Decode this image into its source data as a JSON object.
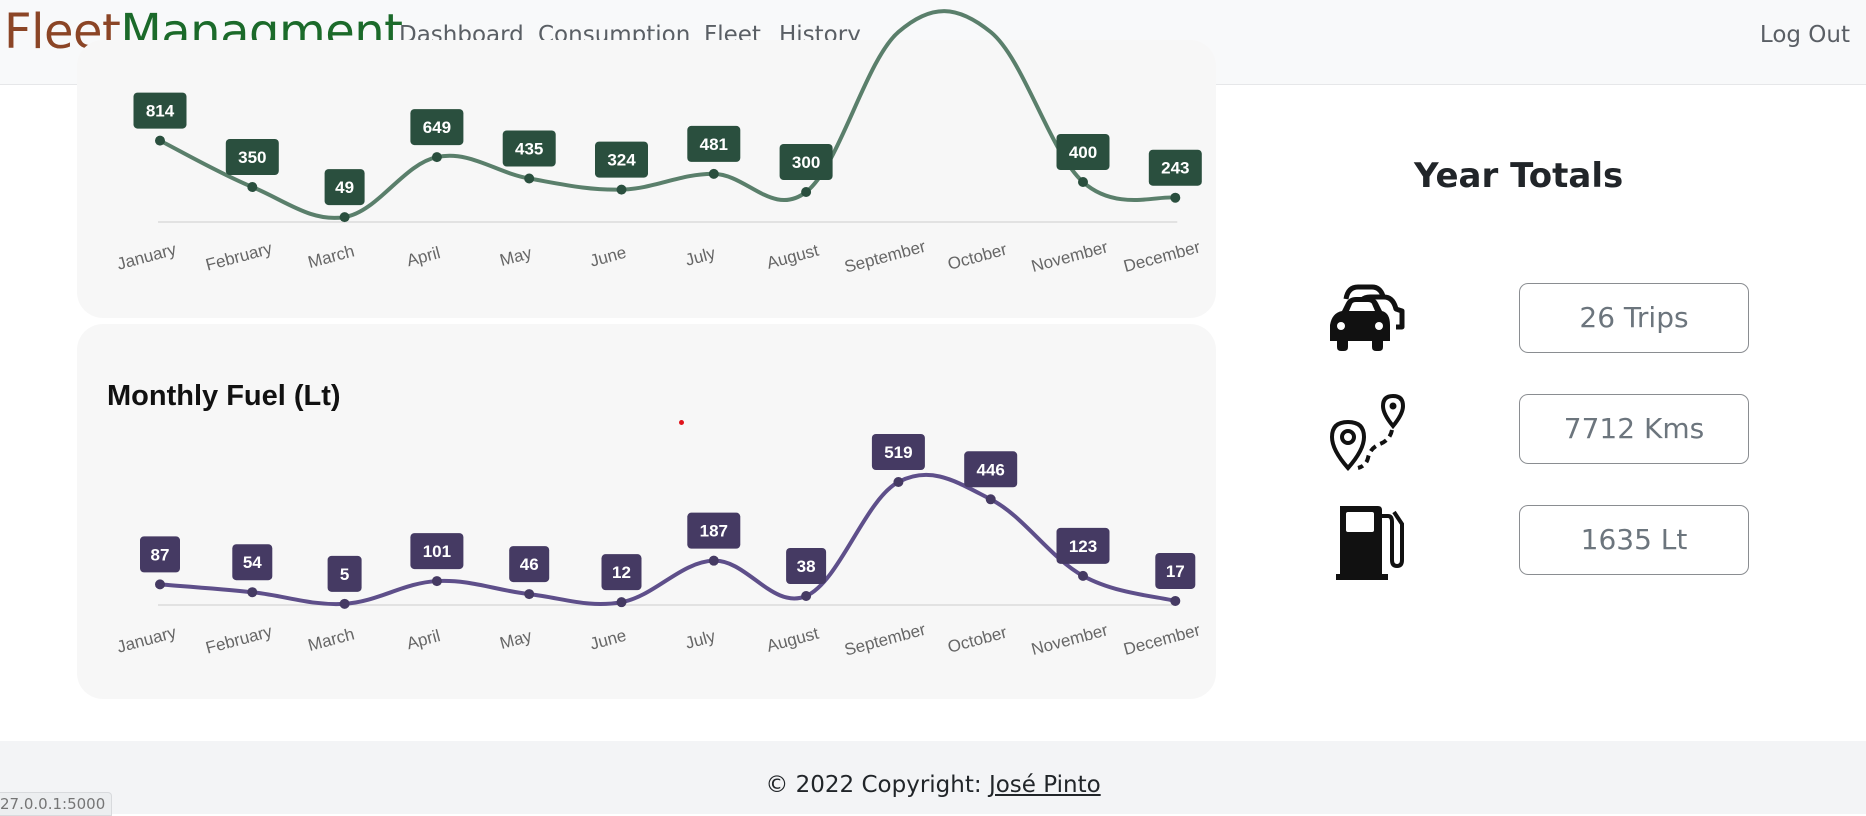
{
  "brand": {
    "part1": "Fleet",
    "part2": "Managment",
    "color1": "#8b4526",
    "color2": "#1b6a2a"
  },
  "nav": {
    "items": [
      {
        "label": "Dashboard"
      },
      {
        "label": "Consumption"
      },
      {
        "label": "Fleet"
      },
      {
        "label": "History"
      }
    ],
    "logout": "Log Out"
  },
  "charts": {
    "fuel_title": "Monthly Fuel (Lt)"
  },
  "chart_data": [
    {
      "type": "line",
      "title": "",
      "categories": [
        "January",
        "February",
        "March",
        "April",
        "May",
        "June",
        "July",
        "August",
        "September",
        "October",
        "November",
        "December"
      ],
      "values": [
        814,
        350,
        49,
        649,
        435,
        324,
        481,
        300,
        null,
        null,
        400,
        243
      ],
      "note_visible": "September and October points are cut off above the visible area",
      "color": "#5a7f6b",
      "label_color": "#2a4f3e"
    },
    {
      "type": "line",
      "title": "Monthly Fuel (Lt)",
      "categories": [
        "January",
        "February",
        "March",
        "April",
        "May",
        "June",
        "July",
        "August",
        "September",
        "October",
        "November",
        "December"
      ],
      "values": [
        87,
        54,
        5,
        101,
        46,
        12,
        187,
        38,
        519,
        446,
        123,
        17
      ],
      "color": "#5e4f8a",
      "label_color": "#453a63"
    }
  ],
  "totals": {
    "title": "Year Totals",
    "trips": "26 Trips",
    "kms": "7712 Kms",
    "fuel": "1635 Lt",
    "icons": [
      "cars-icon",
      "route-pins-icon",
      "fuel-pump-icon"
    ]
  },
  "footer": {
    "copyright": "© 2022 Copyright: ",
    "author": "José Pinto"
  },
  "status_bar": {
    "url": "27.0.0.1:5000"
  }
}
